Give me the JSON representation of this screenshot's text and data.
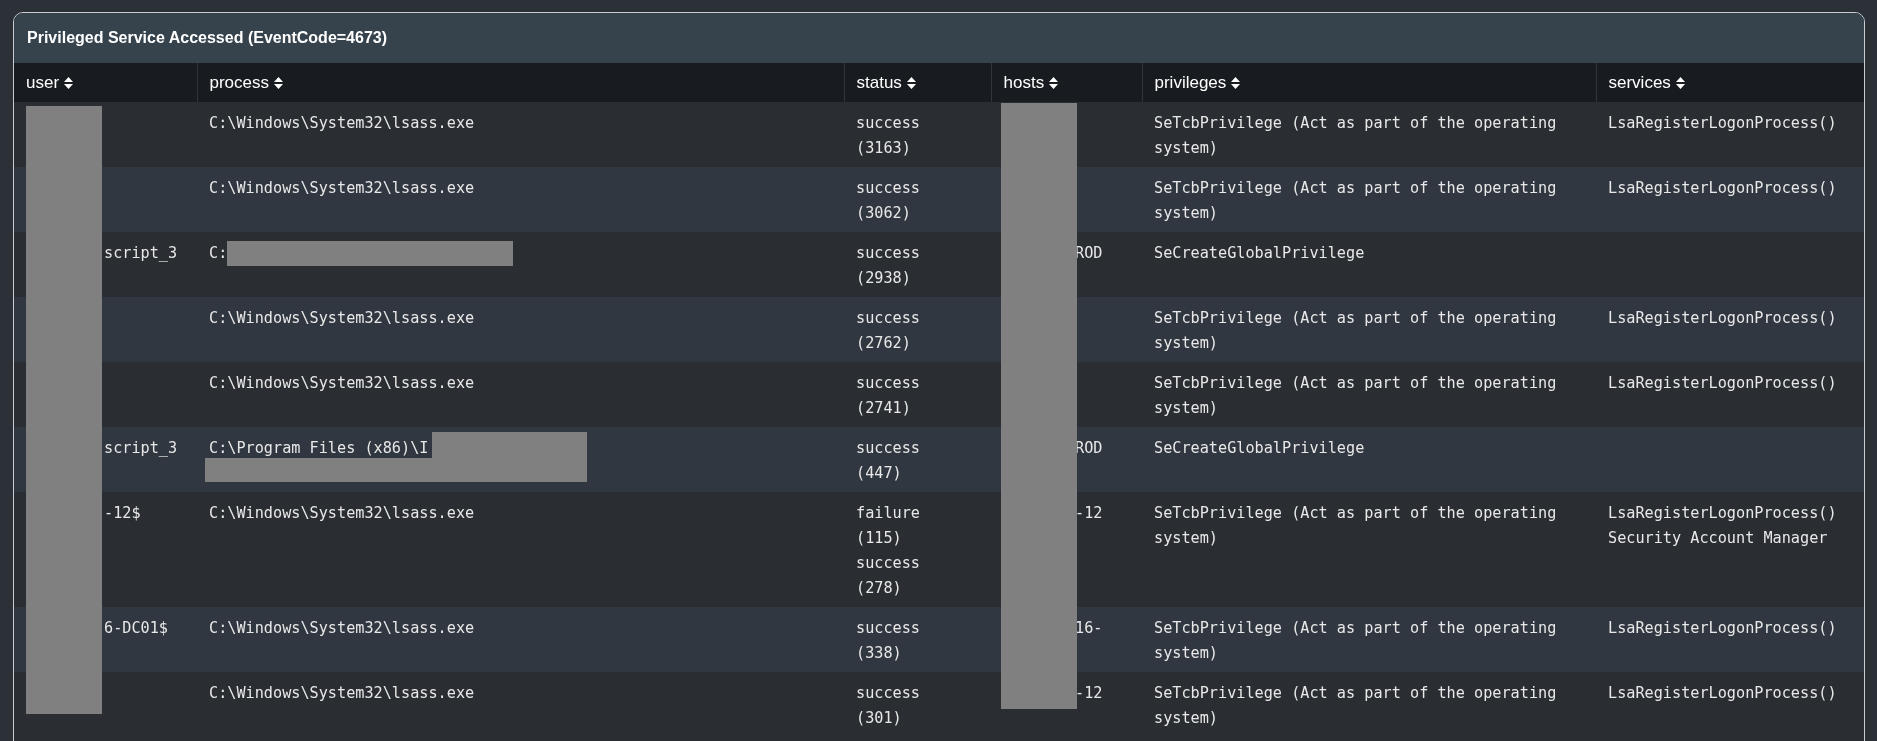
{
  "panel": {
    "title": "Privileged Service Accessed (EventCode=4673)"
  },
  "table": {
    "columns": [
      {
        "label": "user",
        "kind": "redacted"
      },
      {
        "label": "process",
        "kind": "plain"
      },
      {
        "label": "status",
        "kind": "plain"
      },
      {
        "label": "hosts",
        "kind": "redacted"
      },
      {
        "label": "privileges",
        "kind": "plain"
      },
      {
        "label": "services",
        "kind": "plain"
      }
    ],
    "rows": [
      {
        "user": "",
        "process": {
          "text": "C:\\Windows\\System32\\lsass.exe",
          "kind": "plain"
        },
        "status": [
          {
            "result": "success",
            "count": "(3163)"
          }
        ],
        "hosts": "",
        "privileges": "SeTcbPrivilege (Act as part of the operating system)",
        "services": [
          "LsaRegisterLogonProcess()"
        ]
      },
      {
        "user": "",
        "process": {
          "text": "C:\\Windows\\System32\\lsass.exe",
          "kind": "plain"
        },
        "status": [
          {
            "result": "success",
            "count": "(3062)"
          }
        ],
        "hosts": "",
        "privileges": "SeTcbPrivilege (Act as part of the operating system)",
        "services": [
          "LsaRegisterLogonProcess()"
        ]
      },
      {
        "user": "script_3",
        "process": {
          "text": "C:",
          "kind": "redacted_inline"
        },
        "status": [
          {
            "result": "success",
            "count": "(2938)"
          }
        ],
        "hosts": "ROD",
        "privileges": "SeCreateGlobalPrivilege",
        "services": []
      },
      {
        "user": "",
        "process": {
          "text": "C:\\Windows\\System32\\lsass.exe",
          "kind": "plain"
        },
        "status": [
          {
            "result": "success",
            "count": "(2762)"
          }
        ],
        "hosts": "",
        "privileges": "SeTcbPrivilege (Act as part of the operating system)",
        "services": [
          "LsaRegisterLogonProcess()"
        ]
      },
      {
        "user": "",
        "process": {
          "text": "C:\\Windows\\System32\\lsass.exe",
          "kind": "plain"
        },
        "status": [
          {
            "result": "success",
            "count": "(2741)"
          }
        ],
        "hosts": "",
        "privileges": "SeTcbPrivilege (Act as part of the operating system)",
        "services": [
          "LsaRegisterLogonProcess()"
        ]
      },
      {
        "user": "script_3",
        "process": {
          "text": "C:\\Program Files (x86)\\I",
          "kind": "redacted_two_lines"
        },
        "status": [
          {
            "result": "success",
            "count": "(447)"
          }
        ],
        "hosts": "ROD",
        "privileges": "SeCreateGlobalPrivilege",
        "services": []
      },
      {
        "user": "-12$",
        "process": {
          "text": "C:\\Windows\\System32\\lsass.exe",
          "kind": "plain"
        },
        "status": [
          {
            "result": "failure",
            "count": "(115)"
          },
          {
            "result": "success",
            "count": "(278)"
          }
        ],
        "hosts": "-12",
        "privileges": "SeTcbPrivilege (Act as part of the operating system)",
        "services": [
          "LsaRegisterLogonProcess()",
          "Security Account Manager"
        ]
      },
      {
        "user": "6-DC01$",
        "process": {
          "text": "C:\\Windows\\System32\\lsass.exe",
          "kind": "plain"
        },
        "status": [
          {
            "result": "success",
            "count": "(338)"
          }
        ],
        "hosts": "16-",
        "privileges": "SeTcbPrivilege (Act as part of the operating system)",
        "services": [
          "LsaRegisterLogonProcess()"
        ]
      },
      {
        "user": "",
        "process": {
          "text": "C:\\Windows\\System32\\lsass.exe",
          "kind": "plain"
        },
        "status": [
          {
            "result": "success",
            "count": "(301)"
          }
        ],
        "hosts": "-12",
        "privileges": "SeTcbPrivilege (Act as part of the operating system)",
        "services": [
          "LsaRegisterLogonProcess()"
        ]
      }
    ]
  }
}
